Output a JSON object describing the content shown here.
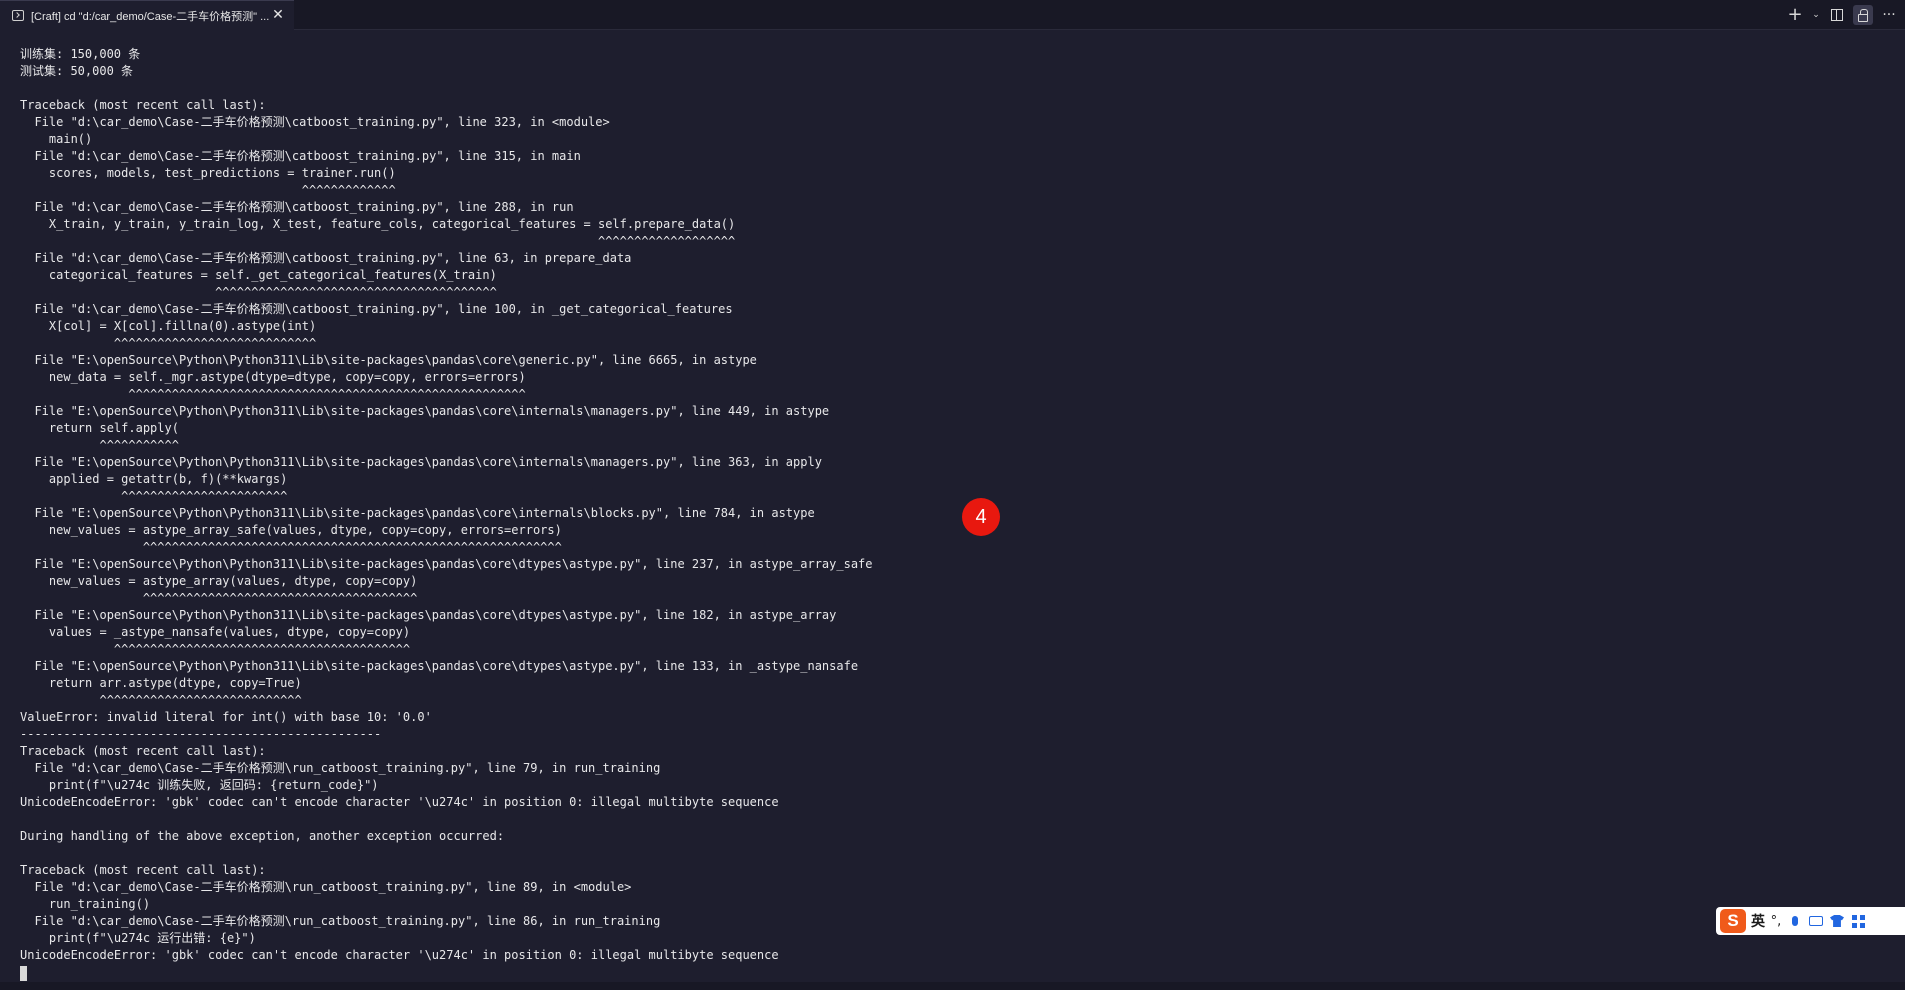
{
  "tab": {
    "title": "[Craft] cd \"d:/car_demo/Case-二手车价格预测\" ...",
    "icon": "terminal-icon",
    "close_icon": "close-icon"
  },
  "toolbar": {
    "new_terminal": "+",
    "dropdown": "⌄",
    "more": "···",
    "icons": [
      "plus-icon",
      "chevron-down-icon",
      "split-panel-icon",
      "lock-icon",
      "more-icon"
    ]
  },
  "terminal": {
    "lines": [
      "训练集: 150,000 条",
      "测试集: 50,000 条",
      "",
      "Traceback (most recent call last):",
      "  File \"d:\\car_demo\\Case-二手车价格预测\\catboost_training.py\", line 323, in <module>",
      "    main()",
      "  File \"d:\\car_demo\\Case-二手车价格预测\\catboost_training.py\", line 315, in main",
      "    scores, models, test_predictions = trainer.run()",
      "                                       ^^^^^^^^^^^^^",
      "  File \"d:\\car_demo\\Case-二手车价格预测\\catboost_training.py\", line 288, in run",
      "    X_train, y_train, y_train_log, X_test, feature_cols, categorical_features = self.prepare_data()",
      "                                                                                ^^^^^^^^^^^^^^^^^^^",
      "  File \"d:\\car_demo\\Case-二手车价格预测\\catboost_training.py\", line 63, in prepare_data",
      "    categorical_features = self._get_categorical_features(X_train)",
      "                           ^^^^^^^^^^^^^^^^^^^^^^^^^^^^^^^^^^^^^^^",
      "  File \"d:\\car_demo\\Case-二手车价格预测\\catboost_training.py\", line 100, in _get_categorical_features",
      "    X[col] = X[col].fillna(0).astype(int)",
      "             ^^^^^^^^^^^^^^^^^^^^^^^^^^^^",
      "  File \"E:\\openSource\\Python\\Python311\\Lib\\site-packages\\pandas\\core\\generic.py\", line 6665, in astype",
      "    new_data = self._mgr.astype(dtype=dtype, copy=copy, errors=errors)",
      "               ^^^^^^^^^^^^^^^^^^^^^^^^^^^^^^^^^^^^^^^^^^^^^^^^^^^^^^^",
      "  File \"E:\\openSource\\Python\\Python311\\Lib\\site-packages\\pandas\\core\\internals\\managers.py\", line 449, in astype",
      "    return self.apply(",
      "           ^^^^^^^^^^^",
      "  File \"E:\\openSource\\Python\\Python311\\Lib\\site-packages\\pandas\\core\\internals\\managers.py\", line 363, in apply",
      "    applied = getattr(b, f)(**kwargs)",
      "              ^^^^^^^^^^^^^^^^^^^^^^^",
      "  File \"E:\\openSource\\Python\\Python311\\Lib\\site-packages\\pandas\\core\\internals\\blocks.py\", line 784, in astype",
      "    new_values = astype_array_safe(values, dtype, copy=copy, errors=errors)",
      "                 ^^^^^^^^^^^^^^^^^^^^^^^^^^^^^^^^^^^^^^^^^^^^^^^^^^^^^^^^^^",
      "  File \"E:\\openSource\\Python\\Python311\\Lib\\site-packages\\pandas\\core\\dtypes\\astype.py\", line 237, in astype_array_safe",
      "    new_values = astype_array(values, dtype, copy=copy)",
      "                 ^^^^^^^^^^^^^^^^^^^^^^^^^^^^^^^^^^^^^^",
      "  File \"E:\\openSource\\Python\\Python311\\Lib\\site-packages\\pandas\\core\\dtypes\\astype.py\", line 182, in astype_array",
      "    values = _astype_nansafe(values, dtype, copy=copy)",
      "             ^^^^^^^^^^^^^^^^^^^^^^^^^^^^^^^^^^^^^^^^^",
      "  File \"E:\\openSource\\Python\\Python311\\Lib\\site-packages\\pandas\\core\\dtypes\\astype.py\", line 133, in _astype_nansafe",
      "    return arr.astype(dtype, copy=True)",
      "           ^^^^^^^^^^^^^^^^^^^^^^^^^^^^",
      "ValueError: invalid literal for int() with base 10: '0.0'",
      "--------------------------------------------------",
      "Traceback (most recent call last):",
      "  File \"d:\\car_demo\\Case-二手车价格预测\\run_catboost_training.py\", line 79, in run_training",
      "    print(f\"\\u274c 训练失败, 返回码: {return_code}\")",
      "UnicodeEncodeError: 'gbk' codec can't encode character '\\u274c' in position 0: illegal multibyte sequence",
      "",
      "During handling of the above exception, another exception occurred:",
      "",
      "Traceback (most recent call last):",
      "  File \"d:\\car_demo\\Case-二手车价格预测\\run_catboost_training.py\", line 89, in <module>",
      "    run_training()",
      "  File \"d:\\car_demo\\Case-二手车价格预测\\run_catboost_training.py\", line 86, in run_training",
      "    print(f\"\\u274c 运行出错: {e}\")",
      "UnicodeEncodeError: 'gbk' codec can't encode character '\\u274c' in position 0: illegal multibyte sequence"
    ]
  },
  "badge": {
    "number": "4",
    "color": "#e8180f"
  },
  "ime": {
    "logo": "S",
    "language": "英",
    "punctuation": "°,",
    "icons": [
      "microphone-icon",
      "keyboard-icon",
      "skin-icon",
      "toolbox-icon"
    ]
  }
}
